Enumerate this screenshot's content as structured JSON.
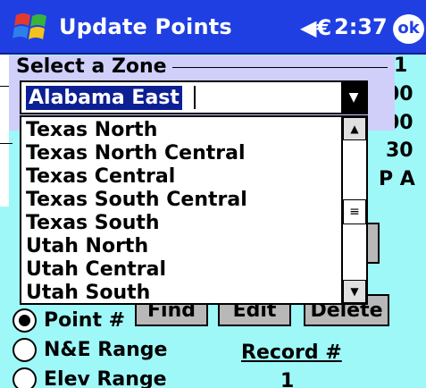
{
  "titlebar": {
    "title": "Update Points",
    "speaker_icon": "speaker-muted-icon",
    "speaker_glyph": "◀€",
    "time": "2:37",
    "ok_label": "ok",
    "accent": "#1f3fe3"
  },
  "background": {
    "right_column": [
      "1",
      "00",
      "00",
      "30",
      "P A"
    ],
    "buttons": [
      "Find",
      "Edit",
      "Delete"
    ],
    "radios": [
      {
        "label": "Point #",
        "checked": true
      },
      {
        "label": "N&E Range",
        "checked": false
      },
      {
        "label": "Elev Range",
        "checked": false
      }
    ],
    "record_label": "Record #",
    "record_value": "1",
    "form_color": "#9ff8f8"
  },
  "zone_dialog": {
    "title": "Select a Zone",
    "selected": "Alabama East",
    "items": [
      "Texas North",
      "Texas North Central",
      "Texas Central",
      "Texas South Central",
      "Texas South",
      "Utah North",
      "Utah Central",
      "Utah South"
    ]
  }
}
